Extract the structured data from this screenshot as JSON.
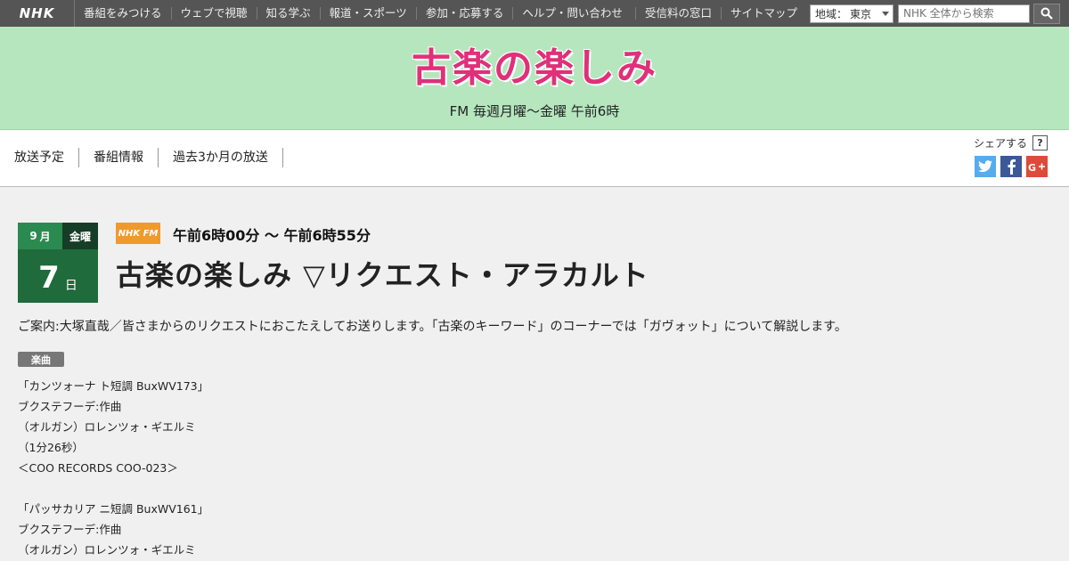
{
  "topbar": {
    "logo": "NHK",
    "nav": [
      "番組をみつける",
      "ウェブで視聴",
      "知る学ぶ",
      "報道・スポーツ",
      "参加・応募する",
      "ヘルプ・問い合わせ"
    ],
    "links": [
      "受信料の窓口",
      "サイトマップ"
    ],
    "region_label": "地域：",
    "region_value": "東京",
    "search_placeholder": "NHK 全体から検索"
  },
  "hero": {
    "title": "古楽の楽しみ",
    "schedule": "FM 毎週月曜～金曜 午前6時"
  },
  "subnav": {
    "tabs": [
      "放送予定",
      "番組情報",
      "過去3か月の放送"
    ],
    "share_label": "シェアする",
    "help_label": "?"
  },
  "episode": {
    "month": "9",
    "month_unit": "月",
    "weekday": "金曜",
    "day": "7",
    "day_unit": "日",
    "channel": "NHK FM",
    "time": "午前6時00分 ～ 午前6時55分",
    "title": "古楽の楽しみ ▽リクエスト・アラカルト",
    "description": "ご案内:大塚直哉／皆さまからのリクエストにおこたえしてお送りします。「古楽のキーワード」のコーナーでは「ガヴォット」について解説します。",
    "tag": "楽曲",
    "tracks": [
      [
        "「カンツォーナ ト短調 BuxWV173」",
        "ブクステフーデ:作曲",
        "（オルガン）ロレンツォ・ギエルミ",
        "（1分26秒）",
        "＜COO RECORDS COO-023＞"
      ],
      [
        "「パッサカリア ニ短調 BuxWV161」",
        "ブクステフーデ:作曲",
        "（オルガン）ロレンツォ・ギエルミ"
      ]
    ]
  },
  "colors": {
    "topbar": "#555555",
    "hero_bg": "#b6e6be",
    "title_pink": "#e0307a",
    "date_green": "#1f6b3c",
    "fm_orange": "#f09a2e",
    "twitter": "#55acee",
    "facebook": "#3b5998",
    "gplus": "#dd4b39"
  }
}
